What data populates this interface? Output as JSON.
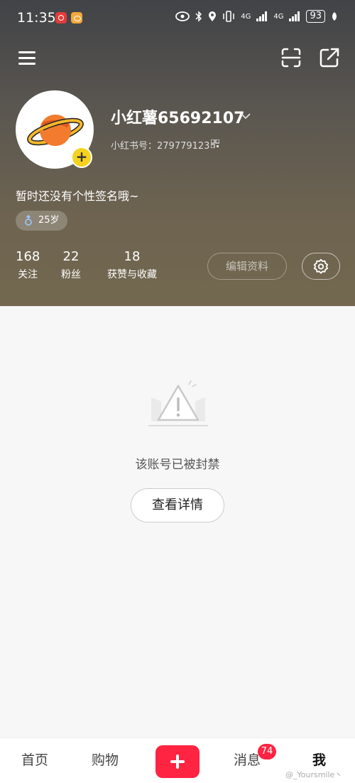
{
  "status_bar": {
    "time": "11:35",
    "network": "4G",
    "battery": "93"
  },
  "profile": {
    "username": "小红薯65692107",
    "redbook_id": "小红书号：279779123",
    "bio": "暂时还没有个性签名哦~",
    "age": "25岁"
  },
  "stats": [
    {
      "value": "168",
      "label": "关注"
    },
    {
      "value": "22",
      "label": "粉丝"
    },
    {
      "value": "18",
      "label": "获赞与收藏"
    }
  ],
  "buttons": {
    "edit_profile": "编辑资料",
    "view_details": "查看详情"
  },
  "notice": {
    "banned_text": "该账号已被封禁"
  },
  "bottom_nav": {
    "home": "首页",
    "shop": "购物",
    "messages": "消息",
    "messages_badge": "74",
    "me": "我"
  },
  "watermark": "@_Yoursmile丶",
  "colors": {
    "accent": "#ff2442",
    "avatar_plus": "#f5d21e"
  },
  "icons": [
    "menu-icon",
    "scan-icon",
    "share-icon",
    "planet-avatar",
    "chevron-down-icon",
    "qr-code-icon",
    "gender-icon",
    "gear-icon",
    "warning-icon",
    "plus-icon"
  ]
}
